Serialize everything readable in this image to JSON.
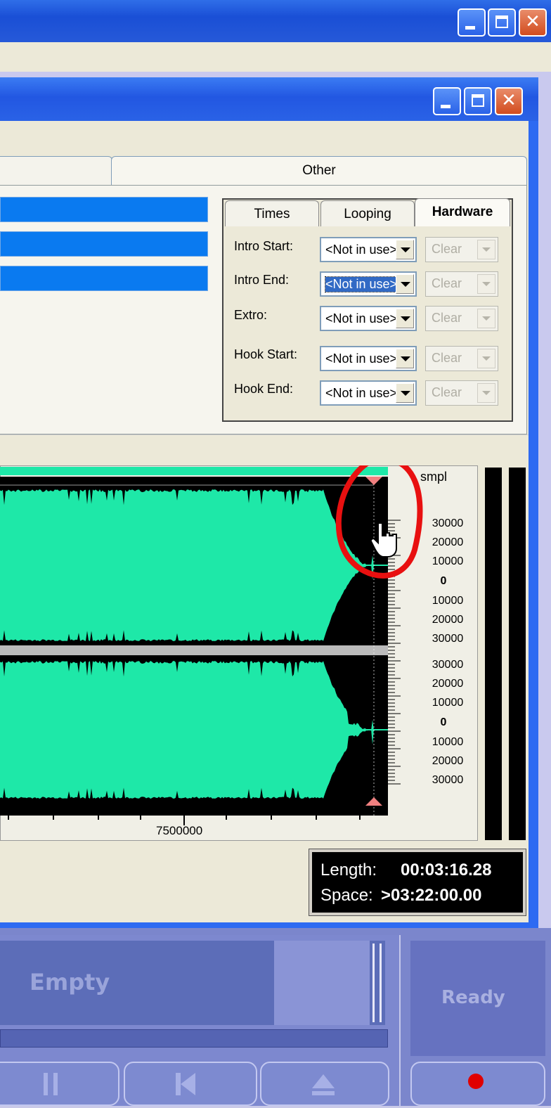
{
  "tabs": {
    "other": "Other"
  },
  "subtabs": [
    "Times",
    "Looping",
    "Hardware"
  ],
  "fields": [
    {
      "label": "Intro Start:",
      "value": "<Not in use>",
      "clear": "Clear",
      "selected": false
    },
    {
      "label": "Intro End:",
      "value": "<Not in use>",
      "clear": "Clear",
      "selected": true
    },
    {
      "label": "Extro:",
      "value": "<Not in use>",
      "clear": "Clear",
      "selected": false
    },
    {
      "label": "Hook Start:",
      "value": "<Not in use>",
      "clear": "Clear",
      "selected": false
    },
    {
      "label": "Hook End:",
      "value": "<Not in use>",
      "clear": "Clear",
      "selected": false
    }
  ],
  "waveform": {
    "unit": "smpl",
    "y_labels": [
      "30000",
      "20000",
      "10000",
      "0",
      "10000",
      "20000",
      "30000"
    ],
    "x_label": "7500000"
  },
  "length": {
    "length_label": "Length:",
    "length_value": "00:03:16.28",
    "space_label": "Space:",
    "space_value": ">03:22:00.00"
  },
  "player": {
    "empty": "Empty",
    "ready": "Ready"
  },
  "colors": {
    "wave": "#1ee8a8",
    "titlebar": "#2459dc",
    "selection": "#0a7af0"
  }
}
